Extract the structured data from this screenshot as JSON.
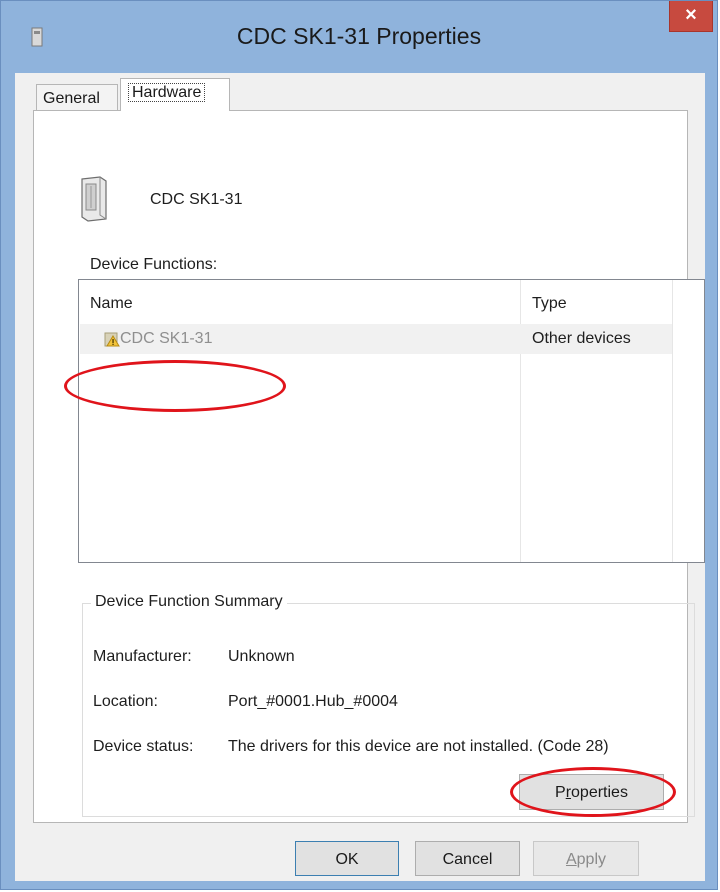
{
  "window": {
    "title": "CDC SK1-31 Properties",
    "close_glyph": "×"
  },
  "tabs": [
    {
      "label": "General"
    },
    {
      "label": "Hardware"
    }
  ],
  "device": {
    "name": "CDC SK1-31",
    "icon": "usb-device-icon"
  },
  "device_functions": {
    "label": "Device Functions:",
    "columns": [
      "Name",
      "Type"
    ],
    "rows": [
      {
        "name": "CDC SK1-31",
        "type": "Other devices",
        "icon": "warning-device-icon"
      }
    ]
  },
  "summary": {
    "legend": "Device Function Summary",
    "manufacturer_label": "Manufacturer:",
    "manufacturer_value": "Unknown",
    "location_label": "Location:",
    "location_value": "Port_#0001.Hub_#0004",
    "status_label": "Device status:",
    "status_value": "The drivers for this device are not installed. (Code 28)"
  },
  "buttons": {
    "properties_pre": "P",
    "properties_u": "r",
    "properties_post": "operties",
    "ok": "OK",
    "cancel": "Cancel",
    "apply_u": "A",
    "apply_post": "pply"
  },
  "colors": {
    "frame": "#8fb3dc",
    "close": "#c74a3f",
    "annotation": "#e0141b"
  }
}
